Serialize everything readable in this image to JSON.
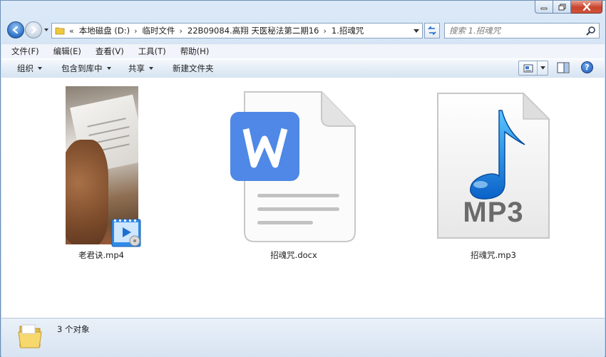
{
  "window": {
    "caption_buttons": {
      "minimize": "minimize-icon",
      "maximize": "maximize-icon",
      "close": "close-icon"
    }
  },
  "nav": {
    "breadcrumb": [
      "本地磁盘 (D:)",
      "临时文件",
      "22B09084.高翔 天医秘法第二期16",
      "1.招魂咒"
    ],
    "overflow": "«",
    "search_placeholder": "搜索 1.招魂咒"
  },
  "menu": [
    "文件(F)",
    "编辑(E)",
    "查看(V)",
    "工具(T)",
    "帮助(H)"
  ],
  "toolbar": {
    "organize": "组织",
    "include": "包含到库中",
    "share": "共享",
    "new_folder": "新建文件夹",
    "help": "?"
  },
  "files": [
    {
      "name": "老君诀.mp4",
      "type": "video"
    },
    {
      "name": "招魂咒.docx",
      "type": "docx",
      "icon_letter": "W"
    },
    {
      "name": "招魂咒.mp3",
      "type": "mp3",
      "icon_text": "MP3"
    }
  ],
  "status": {
    "count": "3 个对象"
  },
  "colors": {
    "wps_blue": "#4f88e6",
    "mp3_blue": "#1e8fe0",
    "folder_yellow": "#f3d269"
  }
}
